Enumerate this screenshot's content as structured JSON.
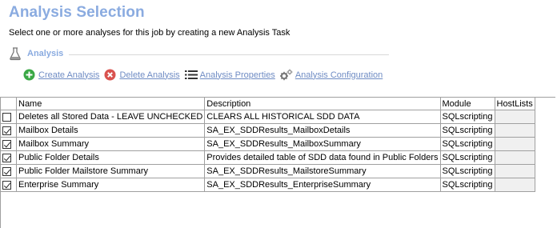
{
  "header": {
    "title": "Analysis Selection",
    "subtitle": "Select one or more analyses for this job by creating a new Analysis Task"
  },
  "section": {
    "label": "Analysis",
    "icon": "flask-icon"
  },
  "toolbar": {
    "create_label": "Create Analysis",
    "delete_label": "Delete Analysis",
    "properties_label": "Analysis Properties",
    "configuration_label": "Analysis Configuration"
  },
  "grid": {
    "columns": [
      "Name",
      "Description",
      "Module",
      "HostLists"
    ],
    "rows": [
      {
        "checked": false,
        "name": "Deletes all Stored Data - LEAVE UNCHECKED",
        "description": "CLEARS ALL HISTORICAL SDD DATA",
        "module": "SQLscripting",
        "hostlists": ""
      },
      {
        "checked": true,
        "name": "Mailbox Details",
        "description": "SA_EX_SDDResults_MailboxDetails",
        "module": "SQLscripting",
        "hostlists": ""
      },
      {
        "checked": true,
        "name": "Mailbox Summary",
        "description": "SA_EX_SDDResults_MailboxSummary",
        "module": "SQLscripting",
        "hostlists": ""
      },
      {
        "checked": true,
        "name": "Public Folder Details",
        "description": "Provides detailed table of SDD data found in Public Folders",
        "module": "SQLscripting",
        "hostlists": ""
      },
      {
        "checked": true,
        "name": "Public Folder Mailstore Summary",
        "description": "SA_EX_SDDResults_MailstoreSummary",
        "module": "SQLscripting",
        "hostlists": ""
      },
      {
        "checked": true,
        "name": "Enterprise Summary",
        "description": "SA_EX_SDDResults_EnterpriseSummary",
        "module": "SQLscripting",
        "hostlists": ""
      }
    ]
  },
  "colors": {
    "title": "#8aabe0",
    "link": "#6f8cc4",
    "create_icon": "#3aa845",
    "delete_icon": "#d9534f",
    "grid_border": "#a0a0a0"
  }
}
